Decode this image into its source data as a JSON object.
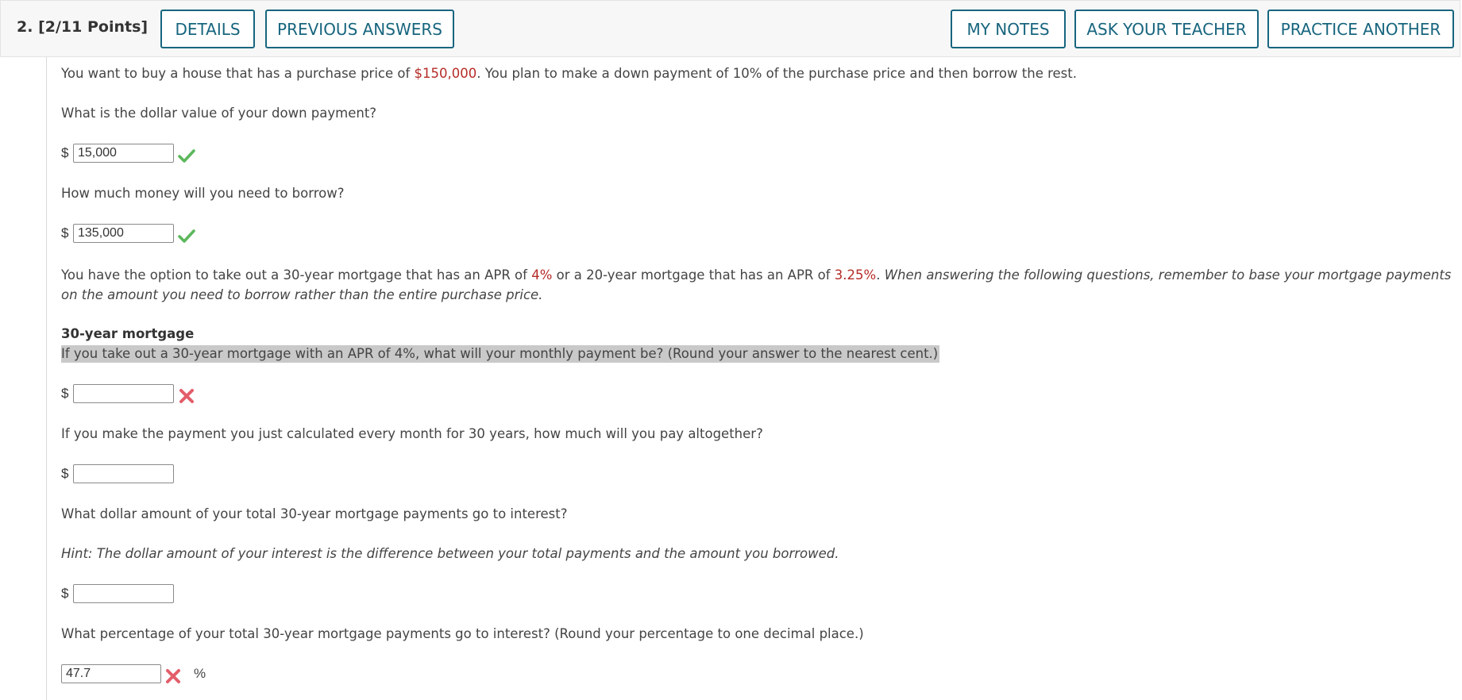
{
  "header": {
    "question_number": "2.",
    "points": "[2/11 Points]",
    "buttons": {
      "details": "DETAILS",
      "previous_answers": "PREVIOUS ANSWERS",
      "my_notes": "MY NOTES",
      "ask_teacher": "ASK YOUR TEACHER",
      "practice_another": "PRACTICE ANOTHER"
    }
  },
  "colors": {
    "button_accent": "#17657e",
    "highlight_value": "#b52b27",
    "correct": "#5cb85c",
    "incorrect": "#e35d6a"
  },
  "intro": {
    "part1": "You want to buy a house that has a purchase price of ",
    "price": "$150,000",
    "part2": ". You plan to make a down payment of 10% of the purchase price and then borrow the rest."
  },
  "questions": {
    "down_payment": {
      "prompt": "What is the dollar value of your down payment?",
      "prefix": "$",
      "value": "15,000",
      "status_icon": "check-icon"
    },
    "borrow": {
      "prompt": "How much money will you need to borrow?",
      "prefix": "$",
      "value": "135,000",
      "status_icon": "check-icon"
    },
    "monthly_payment": {
      "prompt": "If you take out a 30-year mortgage with an APR of 4%, what will your monthly payment be? (Round your answer to the nearest cent.)",
      "prefix": "$",
      "value": "",
      "status_icon": "x-icon"
    },
    "total_paid": {
      "prompt": "If you make the payment you just calculated every month for 30 years, how much will you pay altogether?",
      "prefix": "$",
      "value": ""
    },
    "interest_amount": {
      "prompt": "What dollar amount of your total 30-year mortgage payments go to interest?",
      "hint": "Hint: The dollar amount of your interest is the difference between your total payments and the amount you borrowed.",
      "prefix": "$",
      "value": ""
    },
    "interest_percent": {
      "prompt": "What percentage of your total 30-year mortgage payments go to interest? (Round your percentage to one decimal place.)",
      "value": "47.7",
      "suffix": "%",
      "status_icon": "x-icon"
    }
  },
  "options": {
    "part1": "You have the option to take out a 30-year mortgage that has an APR of ",
    "apr30": "4%",
    "part2": " or a 20-year mortgage that has an APR of ",
    "apr20": "3.25%",
    "part3": ". ",
    "italic_line1": "When answering the following questions, remember to base your mortgage payments",
    "italic_line2": "on the amount you need to borrow rather than the entire purchase price."
  },
  "section_30": {
    "heading": "30-year mortgage"
  }
}
